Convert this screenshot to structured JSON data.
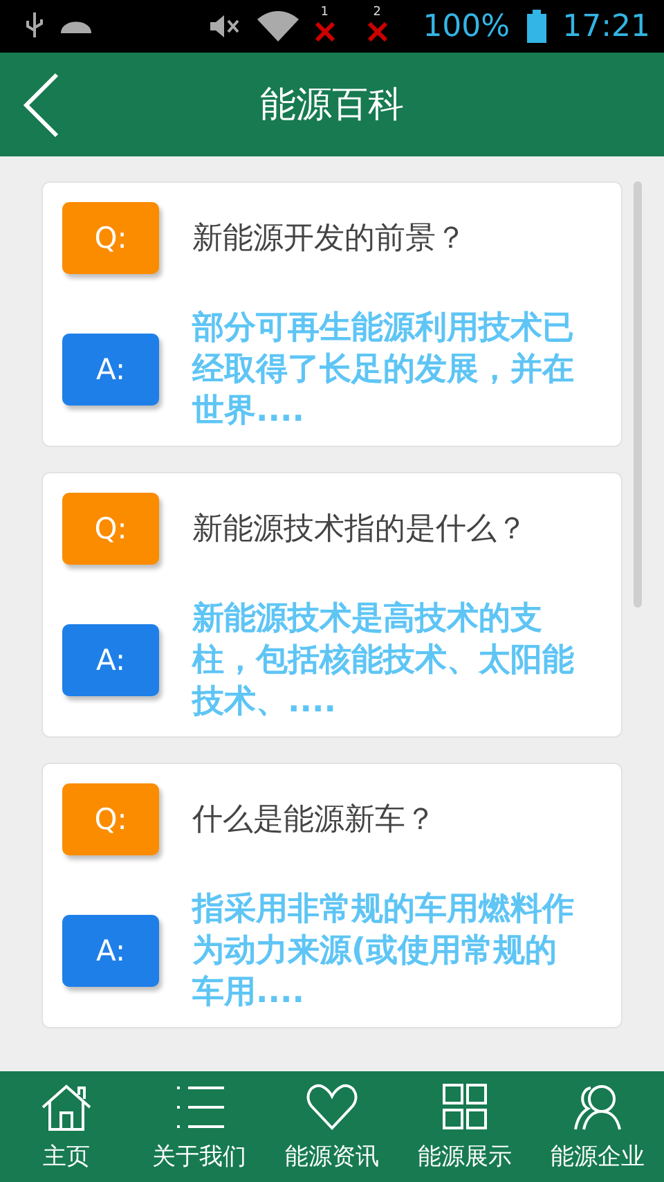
{
  "status_bar": {
    "sim_1": "1",
    "sim_2": "2",
    "battery": "100%",
    "time": "17:21"
  },
  "header": {
    "title": "能源百科"
  },
  "qa_cards": [
    {
      "q_badge": "Q:",
      "question": "新能源开发的前景？",
      "a_badge": "A:",
      "answer": "部分可再生能源利用技术已经取得了长足的发展，并在世界...."
    },
    {
      "q_badge": "Q:",
      "question": "新能源技术指的是什么？",
      "a_badge": "A:",
      "answer": "新能源技术是高技术的支柱，包括核能技术、太阳能技术、...."
    },
    {
      "q_badge": "Q:",
      "question": "什么是能源新车？",
      "a_badge": "A:",
      "answer": "指采用非常规的车用燃料作为动力来源(或使用常规的车用...."
    }
  ],
  "bottom_nav": [
    {
      "kind": "home",
      "label": "主页"
    },
    {
      "kind": "list",
      "label": "关于我们"
    },
    {
      "kind": "heart",
      "label": "能源资讯"
    },
    {
      "kind": "grid",
      "label": "能源展示"
    },
    {
      "kind": "people",
      "label": "能源企业"
    }
  ]
}
